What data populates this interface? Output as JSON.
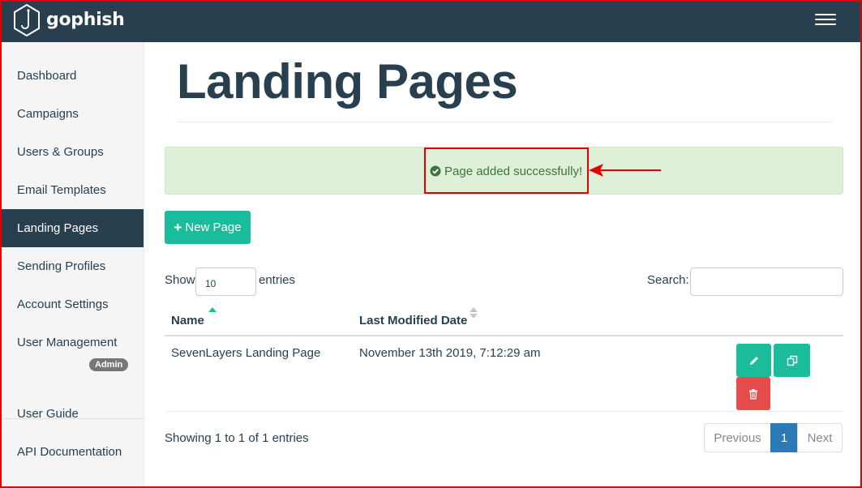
{
  "app": {
    "brand": "gophish"
  },
  "sidebar": {
    "items": [
      {
        "label": "Dashboard"
      },
      {
        "label": "Campaigns"
      },
      {
        "label": "Users & Groups"
      },
      {
        "label": "Email Templates"
      },
      {
        "label": "Landing Pages",
        "active": true
      },
      {
        "label": "Sending Profiles"
      },
      {
        "label": "Account Settings"
      },
      {
        "label": "User Management",
        "badge": "Admin"
      },
      {
        "label": "User Guide"
      },
      {
        "label": "API Documentation"
      }
    ]
  },
  "main": {
    "title": "Landing Pages",
    "alert": {
      "message": "Page added successfully!",
      "icon": "check-circle-icon",
      "color": "#3c763d"
    },
    "new_button_label": "New Page",
    "table_controls": {
      "show_label": "Show",
      "entries_value": "10",
      "entries_label": "entries",
      "search_label": "Search:",
      "search_value": ""
    },
    "table": {
      "columns": [
        "Name",
        "Last Modified Date"
      ],
      "rows": [
        {
          "name": "SevenLayers Landing Page",
          "modified": "November 13th 2019, 7:12:29 am"
        }
      ]
    },
    "info": "Showing 1 to 1 of 1 entries",
    "pagination": {
      "previous": "Previous",
      "current": "1",
      "next": "Next"
    }
  },
  "colors": {
    "navbar": "#283f50",
    "accent": "#1abc9c",
    "danger": "#e74c4c",
    "alert_bg": "#dff0d8",
    "pager_active": "#2b7ab7",
    "annotation": "#e30000"
  }
}
